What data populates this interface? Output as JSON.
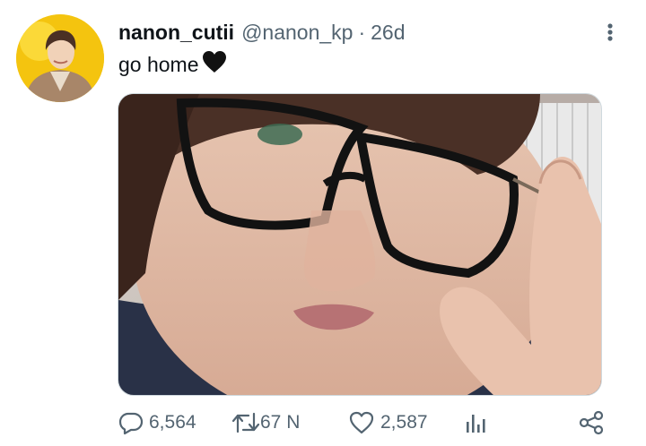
{
  "tweet": {
    "display_name": "nanon_cutii",
    "handle": "@nanon_kp",
    "separator": "·",
    "time": "26d",
    "text": "go home",
    "emoji": "black-heart"
  },
  "media": {
    "description_icon": "photo"
  },
  "actions": {
    "replies": "6,564",
    "retweets": "67 N",
    "likes": "2,587"
  },
  "icons": {
    "more": "more-vertical-icon",
    "reply": "reply-icon",
    "retweet": "retweet-icon",
    "like": "heart-icon",
    "views": "views-chart-icon",
    "share": "share-icon"
  },
  "colors": {
    "text": "#0f1419",
    "secondary": "#536471",
    "avatar_bg": "#f6c60a"
  }
}
